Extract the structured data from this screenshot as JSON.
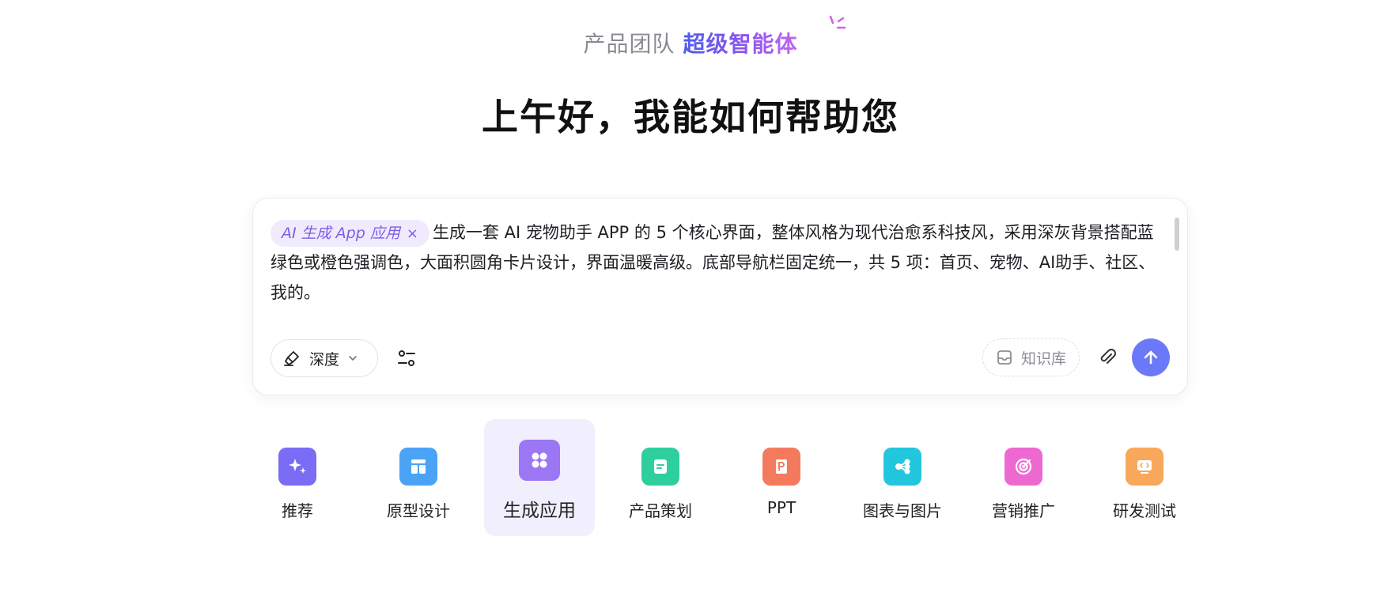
{
  "header": {
    "team_label": "产品团队",
    "agent_label": "超级智能体"
  },
  "greeting": "上午好，我能如何帮助您",
  "composer": {
    "chip_label": "AI 生成 App 应用",
    "chip_close": "×",
    "prompt_text": "生成一套 AI 宠物助手 APP 的 5 个核心界面，整体风格为现代治愈系科技风，采用深灰背景搭配蓝绿色或橙色强调色，大面积圆角卡片设计，界面温暖高级。底部导航栏固定统一，共 5 项：首页、宠物、AI助手、社区、我的。",
    "mode_label": "深度",
    "knowledge_label": "知识库"
  },
  "categories": [
    {
      "label": "推荐",
      "icon": "sparkle-icon",
      "color": "#7a6cf4"
    },
    {
      "label": "原型设计",
      "icon": "layout-icon",
      "color": "#4ba3f5"
    },
    {
      "label": "生成应用",
      "icon": "apps-icon",
      "color": "#9b77f4"
    },
    {
      "label": "产品策划",
      "icon": "document-icon",
      "color": "#2fcf9d"
    },
    {
      "label": "PPT",
      "icon": "ppt-icon",
      "color": "#f47a5e"
    },
    {
      "label": "图表与图片",
      "icon": "chart-share-icon",
      "color": "#22c6dd"
    },
    {
      "label": "营销推广",
      "icon": "target-icon",
      "color": "#ee68d2"
    },
    {
      "label": "研发测试",
      "icon": "code-monitor-icon",
      "color": "#f8a85a"
    }
  ],
  "colors": {
    "accent": "#6b78f7",
    "active_tab_bg": "#f1effe",
    "chip_bg": "#efebfd",
    "chip_text": "#7f5ce6"
  }
}
